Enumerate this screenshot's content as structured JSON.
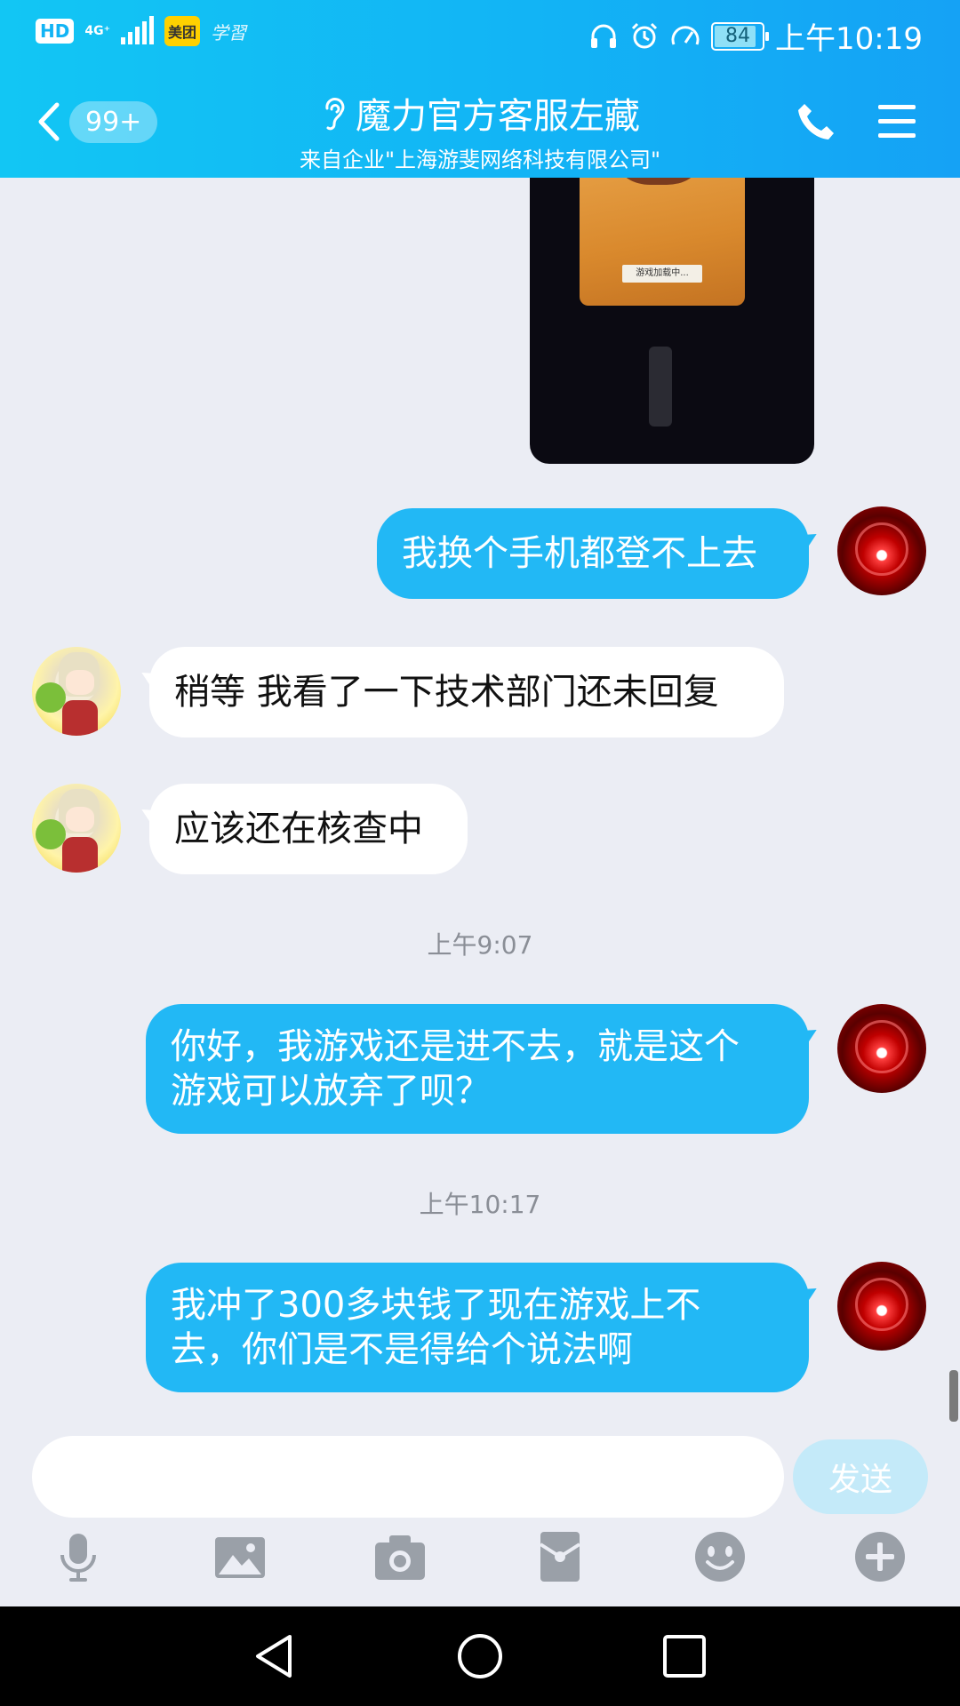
{
  "status_bar": {
    "hd": "HD",
    "network": "4G⁺",
    "app_badge": "美团",
    "app_badge2": "学習",
    "battery": "84",
    "time": "上午10:19"
  },
  "header": {
    "unread_count": "99+",
    "title": "魔力官方客服左藏",
    "subtitle": "来自企业\"上海游斐网络科技有限公司\""
  },
  "image_message": {
    "loading_text": "游戏加载中..."
  },
  "messages": [
    {
      "side": "out",
      "text": "我换个手机都登不上去"
    },
    {
      "side": "in",
      "text": "稍等 我看了一下技术部门还未回复"
    },
    {
      "side": "in",
      "text": "应该还在核查中"
    },
    {
      "timestamp": "上午9:07"
    },
    {
      "side": "out",
      "lines": [
        "你好，我游戏还是进不去，就是这个",
        "游戏可以放弃了呗？"
      ]
    },
    {
      "timestamp": "上午10:17"
    },
    {
      "side": "out",
      "lines": [
        "我冲了300多块钱了现在游戏上不",
        "去，你们是不是得给个说法啊"
      ]
    }
  ],
  "input": {
    "value": "",
    "placeholder": "",
    "send_label": "发送"
  },
  "toolbar": [
    "microphone-icon",
    "image-icon",
    "camera-icon",
    "red-packet-icon",
    "emoji-icon",
    "plus-icon"
  ],
  "colors": {
    "header": "#12b4f5",
    "bubble_out": "#22b8f5",
    "bubble_in": "#ffffff",
    "background": "#ebedf4",
    "send_disabled": "#c4eaf9"
  }
}
